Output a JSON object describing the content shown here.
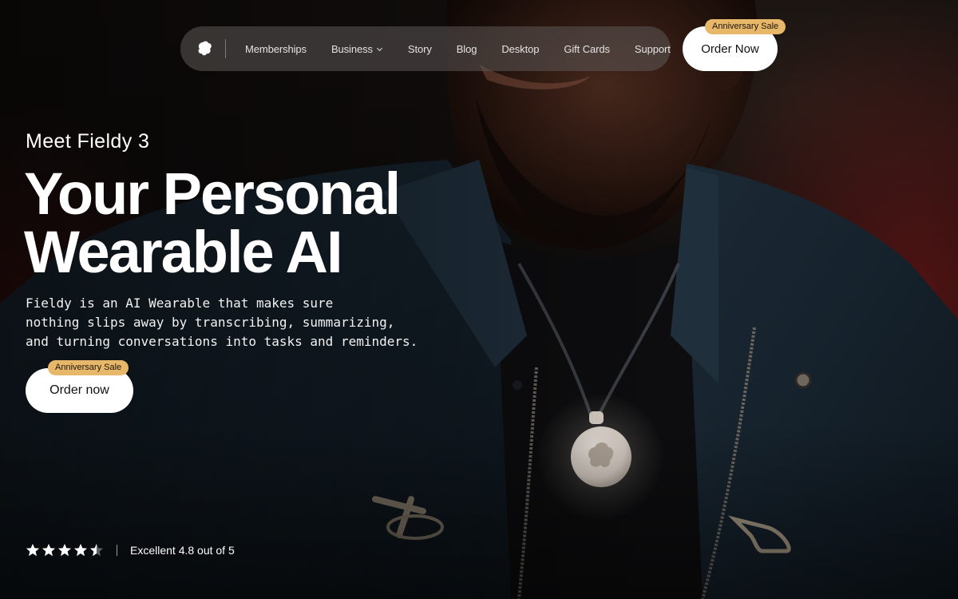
{
  "nav": {
    "logo_icon": "fieldy-logo-icon",
    "links": [
      {
        "label": "Memberships"
      },
      {
        "label": "Business",
        "has_dropdown": true
      },
      {
        "label": "Story"
      },
      {
        "label": "Blog"
      },
      {
        "label": "Desktop"
      },
      {
        "label": "Gift Cards"
      },
      {
        "label": "Support"
      }
    ],
    "order_button": "Order Now",
    "sale_badge": "Anniversary Sale"
  },
  "hero": {
    "eyebrow": "Meet Fieldy 3",
    "headline_line1": "Your Personal",
    "headline_line2": "Wearable AI",
    "description_line1": "Fieldy is an AI Wearable that makes sure",
    "description_line2": "nothing slips away by transcribing, summarizing,",
    "description_line3": "and turning conversations into tasks and reminders.",
    "order_button": "Order now",
    "sale_badge": "Anniversary Sale"
  },
  "rating": {
    "stars": 4.5,
    "text": "Excellent 4.8 out of 5"
  },
  "colors": {
    "badge": "#e8b86a",
    "button_bg": "#ffffff",
    "nav_bg": "rgba(92,88,86,0.55)"
  }
}
